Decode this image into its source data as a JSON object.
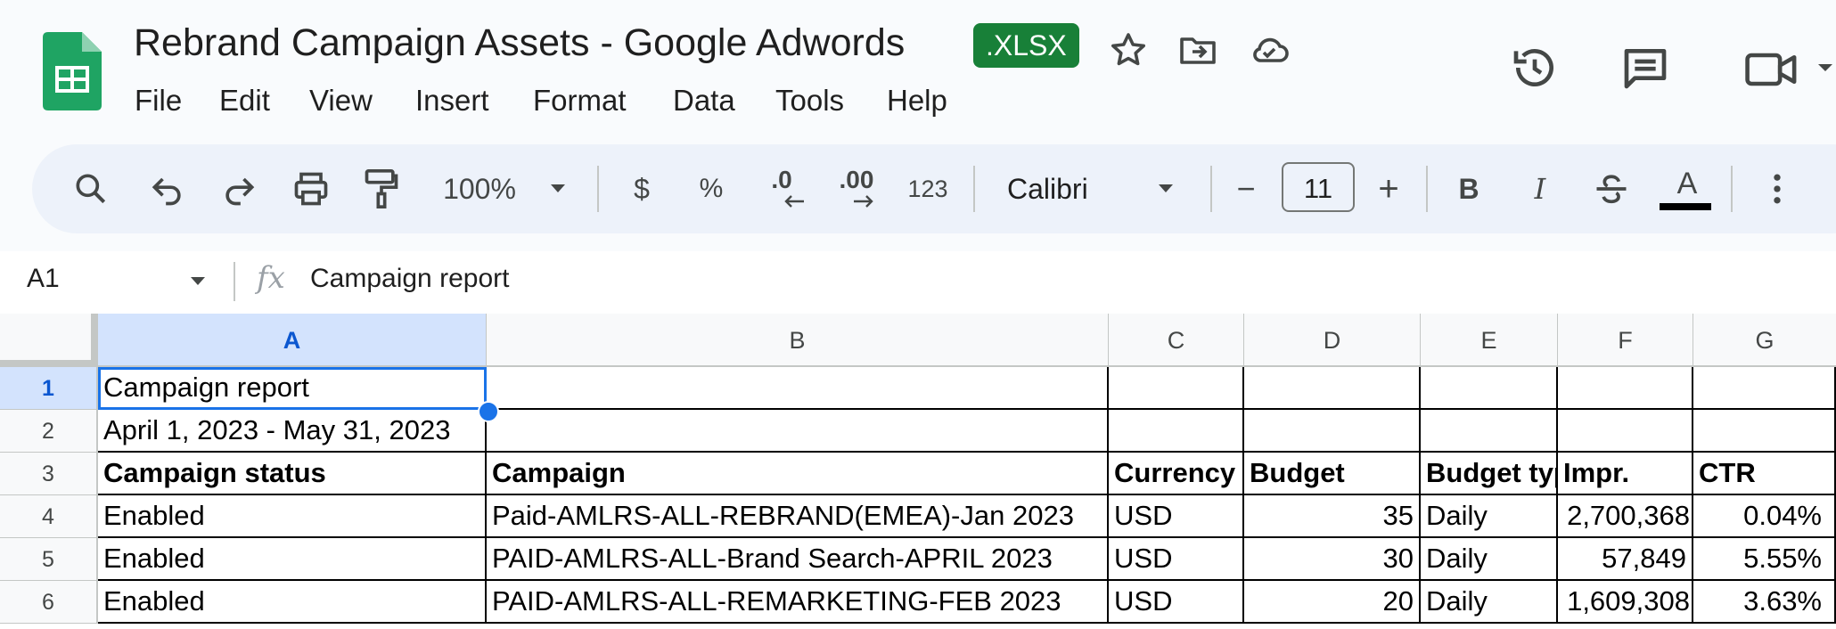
{
  "header": {
    "title": "Rebrand Campaign Assets - Google Adwords",
    "badge": ".XLSX",
    "menu": [
      "File",
      "Edit",
      "View",
      "Insert",
      "Format",
      "Data",
      "Tools",
      "Help"
    ]
  },
  "toolbar": {
    "zoom": "100%",
    "currency_label": "$",
    "percent_label": "%",
    "decrease_decimal": ".0",
    "increase_decimal": ".00",
    "number_format": "123",
    "font_name": "Calibri",
    "font_size": "11",
    "minus": "−",
    "plus": "+",
    "bold": "B",
    "italic": "I",
    "text_color": "A"
  },
  "formula_bar": {
    "cell_ref": "A1",
    "fx": "fx",
    "value": "Campaign report"
  },
  "grid": {
    "columns": [
      "A",
      "B",
      "C",
      "D",
      "E",
      "F",
      "G"
    ],
    "row_numbers": [
      "1",
      "2",
      "3",
      "4",
      "5",
      "6"
    ],
    "rows": [
      [
        "Campaign report",
        "",
        "",
        "",
        "",
        "",
        ""
      ],
      [
        "April 1, 2023 - May 31, 2023",
        "",
        "",
        "",
        "",
        "",
        ""
      ],
      [
        "Campaign status",
        "Campaign",
        "Currency",
        "Budget",
        "Budget type",
        "Impr.",
        "CTR"
      ],
      [
        "Enabled",
        "Paid-AMLRS-ALL-REBRAND(EMEA)-Jan 2023",
        "USD",
        "35",
        "Daily",
        "2,700,368",
        "0.04%"
      ],
      [
        "Enabled",
        "PAID-AMLRS-ALL-Brand Search-APRIL 2023",
        "USD",
        "30",
        "Daily",
        "57,849",
        "5.55%"
      ],
      [
        "Enabled",
        "PAID-AMLRS-ALL-REMARKETING-FEB 2023",
        "USD",
        "20",
        "Daily",
        "1,609,308",
        "3.63%"
      ]
    ]
  },
  "colors": {
    "brand_green": "#188038",
    "selection_blue": "#1a73e8"
  }
}
